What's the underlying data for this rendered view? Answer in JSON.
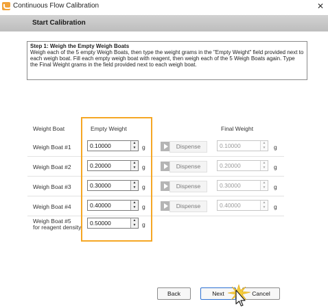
{
  "window": {
    "title": "Continuous Flow Calibration",
    "close_glyph": "✕"
  },
  "header": {
    "title": "Start Calibration"
  },
  "step": {
    "title": "Step 1: Weigh the Empty Weigh Boats",
    "body": "Weigh each of the 5 empty Weigh Boats, then type the weight grams in the \"Empty Weight\" field provided next to each weigh boat. Fill each empty weigh boat with reagent, then weigh each of the 5 Weigh Boats again. Type the Final Weight grams in the field provided next to each weigh boat."
  },
  "columns": {
    "boat": "Weight Boat",
    "empty": "Empty Weight",
    "final": "Final Weight"
  },
  "unit": "g",
  "dispense_label": "Dispense",
  "rows": [
    {
      "label": "Weigh Boat #1",
      "empty": "0.10000",
      "final": "0.10000"
    },
    {
      "label": "Weigh Boat #2",
      "empty": "0.20000",
      "final": "0.20000"
    },
    {
      "label": "Weigh Boat #3",
      "empty": "0.30000",
      "final": "0.30000"
    },
    {
      "label": "Weigh Boat #4",
      "empty": "0.40000",
      "final": "0.40000"
    },
    {
      "label_line1": "Weigh  Boat  #5",
      "label_line2": "for reagent density",
      "empty": "0.50000"
    }
  ],
  "footer": {
    "back": "Back",
    "next": "Next",
    "cancel": "Cancel"
  },
  "colors": {
    "highlight": "#f5a623",
    "header_band": "#c8c8c8",
    "default_button_border": "#2b6fd1"
  }
}
